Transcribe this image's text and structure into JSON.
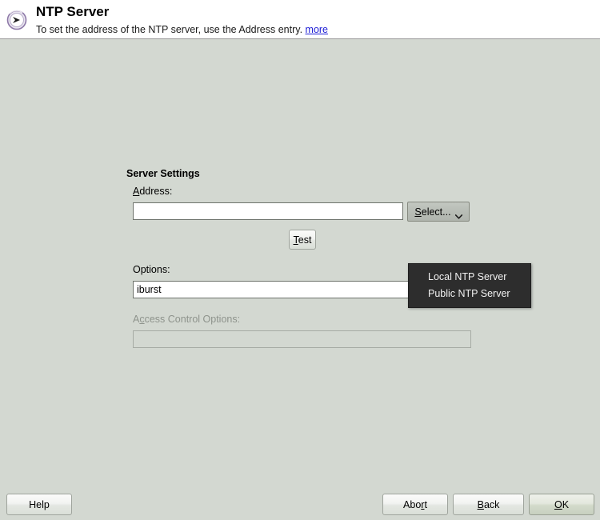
{
  "header": {
    "icon": "ntp-clock-icon",
    "title": "NTP Server",
    "description": "To set the address of the NTP server, use the Address entry.",
    "more_link": "more"
  },
  "form": {
    "group_title": "Server Settings",
    "address": {
      "label_pre": "",
      "label_mnemonic": "A",
      "label_post": "ddress:",
      "value": "",
      "placeholder": ""
    },
    "select_button": {
      "label_mnemonic": "S",
      "label_post": "elect...",
      "icon": "chevron-down-icon"
    },
    "select_menu": {
      "items": [
        {
          "label": "Local NTP Server"
        },
        {
          "label": "Public NTP Server"
        }
      ]
    },
    "test_button": {
      "label_mnemonic": "T",
      "label_post": "est"
    },
    "options": {
      "label": "Options:",
      "value": "iburst",
      "placeholder": ""
    },
    "access_control_options": {
      "label_pre": "A",
      "label_mnemonic": "c",
      "label_post": "cess Control Options:",
      "value": "",
      "placeholder": "",
      "disabled": true
    }
  },
  "footer": {
    "help": {
      "label": "Help"
    },
    "abort": {
      "label_pre": "Abo",
      "label_mnemonic": "r",
      "label_post": "t"
    },
    "back": {
      "label_mnemonic": "B",
      "label_post": "ack"
    },
    "ok": {
      "label_mnemonic": "O",
      "label_post": "K"
    }
  },
  "colors": {
    "body_background": "#d3d8d1",
    "header_background": "#ffffff",
    "link": "#2121d6",
    "menu_background": "#2d2d2d",
    "menu_text": "#f2f2f2",
    "disabled_text": "#8e938c"
  }
}
